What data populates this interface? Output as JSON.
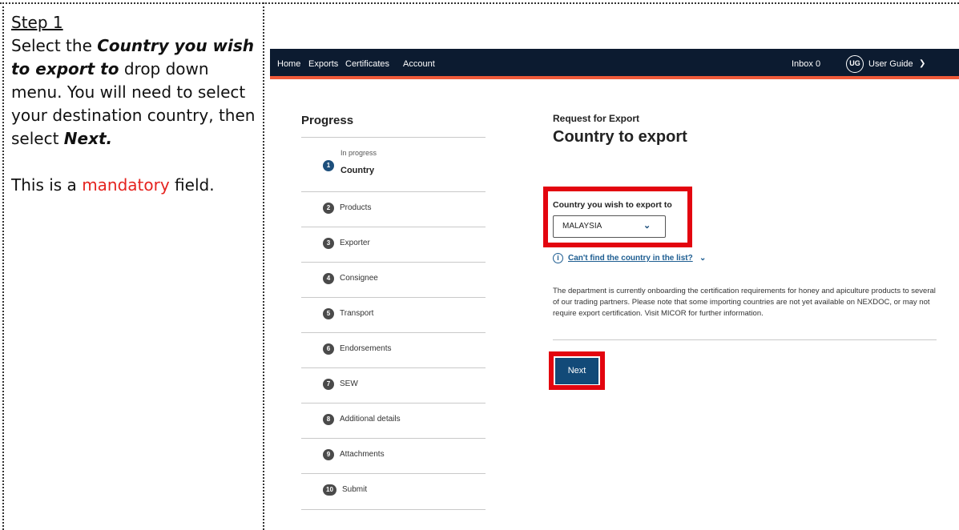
{
  "instructions": {
    "step_title": "Step 1",
    "line1_pre": "Select the ",
    "line1_em": "Country you wish to export to",
    "line1_post": " drop down menu. You will need to select your destination country, then select ",
    "line1_next": "Next.",
    "line2_pre": "This is a ",
    "line2_highlight": "mandatory",
    "line2_post": " field.",
    "highlight_color": "#e5231f"
  },
  "nav": {
    "items": [
      "Home",
      "Exports",
      "Certificates",
      "Account"
    ],
    "inbox_label": "Inbox",
    "inbox_count": "0",
    "avatar_initials": "UG",
    "user_name": "User Guide"
  },
  "progress": {
    "title": "Progress",
    "current_status": "In progress",
    "current_label": "Country",
    "steps": [
      {
        "num": "1",
        "label": "Country"
      },
      {
        "num": "2",
        "label": "Products"
      },
      {
        "num": "3",
        "label": "Exporter"
      },
      {
        "num": "4",
        "label": "Consignee"
      },
      {
        "num": "5",
        "label": "Transport"
      },
      {
        "num": "6",
        "label": "Endorsements"
      },
      {
        "num": "7",
        "label": "SEW"
      },
      {
        "num": "8",
        "label": "Additional details"
      },
      {
        "num": "9",
        "label": "Attachments"
      },
      {
        "num": "10",
        "label": "Submit"
      }
    ]
  },
  "form": {
    "kicker": "Request for Export",
    "title": "Country to export",
    "field_label": "Country you wish to export to",
    "selected_country": "MALAYSIA",
    "help_link": "Can't find the country in the list?",
    "notice": "The department is currently onboarding the certification requirements for honey and apiculture products to several of our trading partners. Please note that some importing countries are not yet available on NEXDOC, or may not require export certification. Visit MICOR for further information.",
    "next_label": "Next"
  },
  "colors": {
    "nav_bg": "#0c1b30",
    "nav_accent": "#f05a3a",
    "primary_button": "#124a78",
    "highlight_box": "#e3050f",
    "link": "#1d5d91"
  }
}
